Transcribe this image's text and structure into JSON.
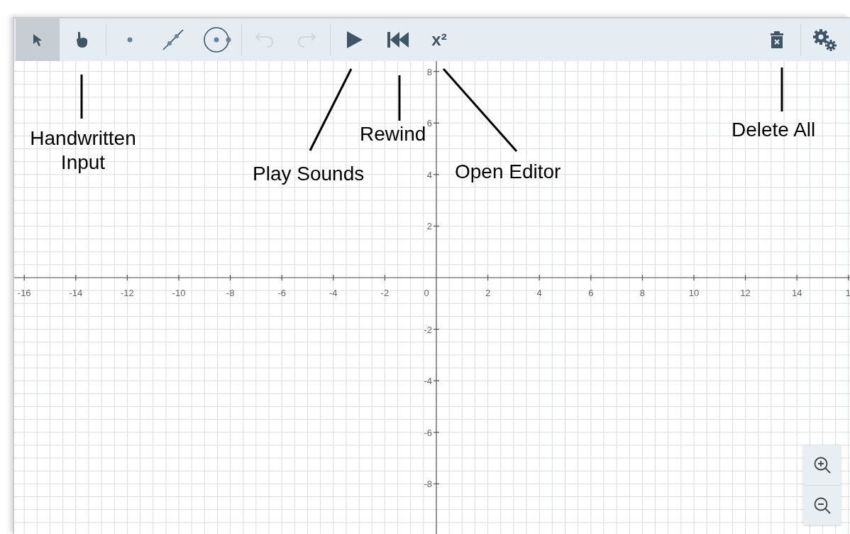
{
  "toolbar": {
    "tools": [
      {
        "kind": "pointer",
        "selected": true,
        "disabled": false
      },
      {
        "kind": "hand",
        "selected": false,
        "disabled": false
      },
      {
        "kind": "divider"
      },
      {
        "kind": "point",
        "selected": false,
        "disabled": false
      },
      {
        "kind": "segment",
        "selected": false,
        "disabled": false
      },
      {
        "kind": "circle",
        "selected": false,
        "disabled": false
      },
      {
        "kind": "divider"
      },
      {
        "kind": "undo",
        "selected": false,
        "disabled": true
      },
      {
        "kind": "redo",
        "selected": false,
        "disabled": true
      },
      {
        "kind": "divider"
      },
      {
        "kind": "play",
        "selected": false,
        "disabled": false
      },
      {
        "kind": "rewind",
        "selected": false,
        "disabled": false
      },
      {
        "kind": "editor",
        "label": "x²",
        "selected": false,
        "disabled": false
      }
    ],
    "right_tools": [
      {
        "kind": "trash"
      },
      {
        "kind": "divider"
      },
      {
        "kind": "settings"
      }
    ]
  },
  "graph": {
    "x_labels": [
      "-16",
      "-14",
      "-12",
      "-10",
      "-8",
      "-6",
      "-4",
      "-2",
      "0",
      "2",
      "4",
      "6",
      "8",
      "10",
      "12",
      "14",
      "1"
    ],
    "y_labels": [
      "8",
      "6",
      "4",
      "2",
      "-2",
      "-4",
      "-6",
      "-8"
    ]
  },
  "annotations": [
    {
      "text": "Handwritten Input"
    },
    {
      "text": "Play Sounds"
    },
    {
      "text": "Rewind"
    },
    {
      "text": "Open Editor"
    },
    {
      "text": "Delete All"
    }
  ],
  "zoom_buttons": [
    {
      "kind": "zoom_in"
    },
    {
      "kind": "zoom_out"
    }
  ]
}
